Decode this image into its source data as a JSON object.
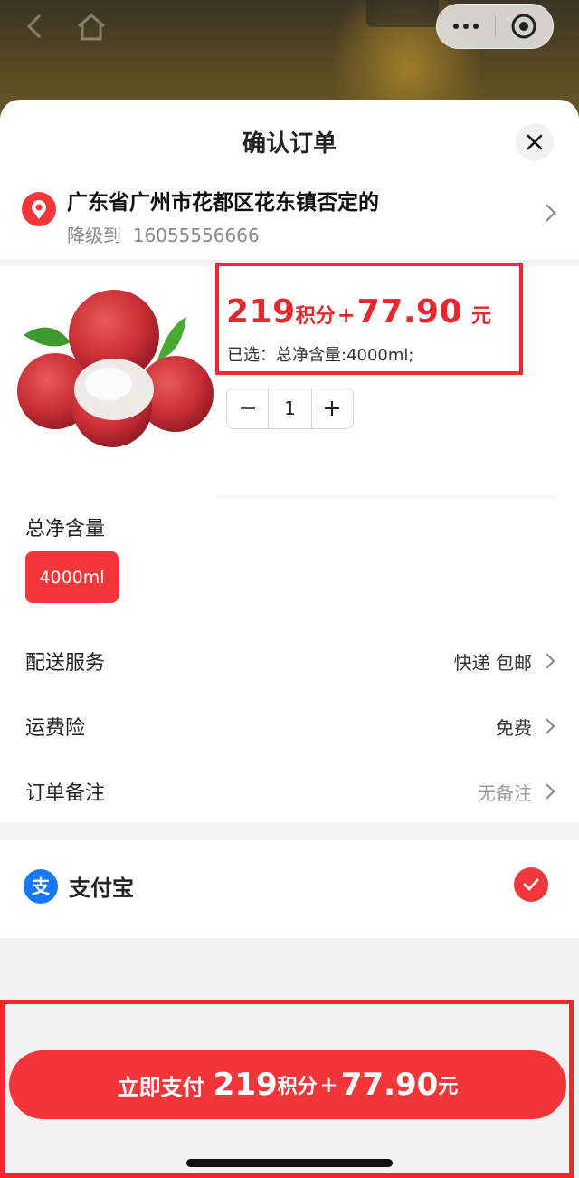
{
  "header": {
    "title": "确认订单"
  },
  "address": {
    "line1": "广东省广州市花都区花东镇否定的",
    "recipient": "降级到",
    "phone": "16055556666"
  },
  "product": {
    "points": "219",
    "points_unit": "积分",
    "plus": "+",
    "price": "77.90",
    "currency": "元",
    "selected_text": "已选：总净含量:4000ml;",
    "quantity": "1",
    "minus": "−",
    "plus_btn": "+"
  },
  "spec": {
    "title": "总净含量",
    "option": "4000ml"
  },
  "rows": [
    {
      "label": "配送服务",
      "value": "快递 包邮"
    },
    {
      "label": "运费险",
      "value": "免费"
    },
    {
      "label": "订单备注",
      "value": "无备注"
    }
  ],
  "payment": {
    "method": "支付宝",
    "logo_text": "支"
  },
  "footer": {
    "pay_label": "立即支付",
    "points": "219",
    "points_unit": "积分",
    "plus": "+",
    "price": "77.90",
    "currency": "元"
  },
  "colors": {
    "accent": "#f23538",
    "highlight_frame": "#f3282e"
  }
}
